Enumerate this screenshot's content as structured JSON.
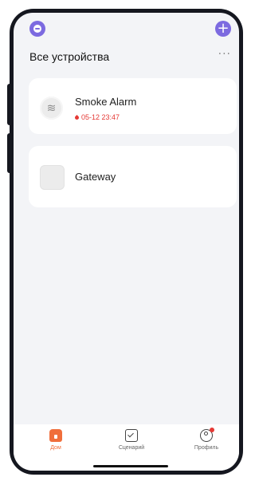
{
  "header": {
    "title": "Все устройства",
    "more_label": "···",
    "add_label": "+"
  },
  "devices": [
    {
      "name": "Smoke Alarm",
      "icon": "smoke-alarm-icon",
      "status_time": "05-12 23:47",
      "status_color": "#e53935"
    },
    {
      "name": "Gateway",
      "icon": "gateway-icon"
    }
  ],
  "tabbar": {
    "tabs": [
      {
        "label": "Дом",
        "icon": "home-icon",
        "active": true
      },
      {
        "label": "Сценарий",
        "icon": "scene-icon",
        "active": false
      },
      {
        "label": "Профиль",
        "icon": "profile-icon",
        "active": false,
        "badge": true
      }
    ]
  },
  "colors": {
    "accent": "#7c6ae0",
    "active_tab": "#f06e3b",
    "alert": "#e53935"
  }
}
